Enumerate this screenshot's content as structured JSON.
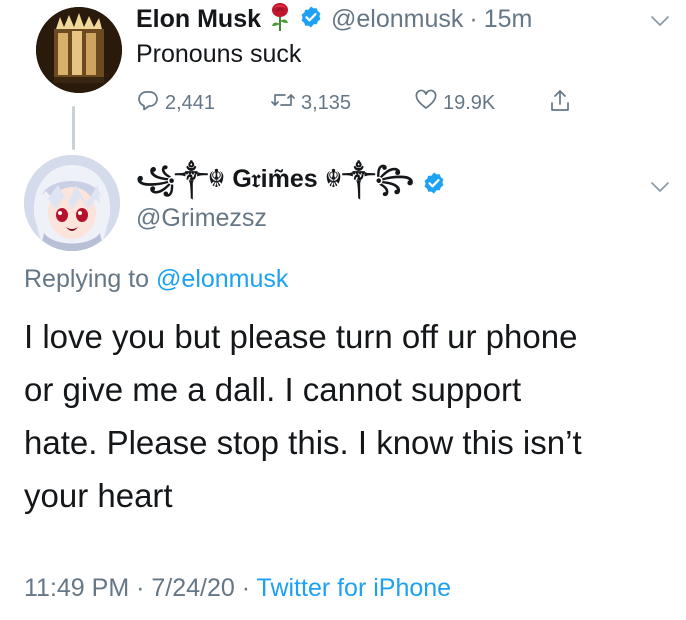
{
  "tweet1": {
    "name": "Elon Musk",
    "name_emoji": "rose-emoji",
    "verified_icon": "verified-badge-icon",
    "handle": "@elonmusk",
    "separator": "·",
    "time": "15m",
    "text": "Pronouns suck",
    "actions": {
      "reply_count": "2,441",
      "retweet_count": "3,135",
      "like_count": "19.9K"
    }
  },
  "tweet2": {
    "display_name": "꧁༒☬ G𝔯im̃es ☬༒꧂",
    "handle": "@Grimezsz",
    "replying_prefix": "Replying to",
    "replying_to": "@elonmusk",
    "text_lines": [
      "I love you but please turn off ur phone",
      "or give me a dall.  I cannot support",
      "hate.  Please stop this. I know this isn’t",
      "your heart"
    ],
    "timestamp": "11:49 PM · 7/24/20",
    "meta_separator": " · ",
    "source": "Twitter for iPhone"
  },
  "colors": {
    "text": "#14171a",
    "secondary": "#657786",
    "link": "#1da1f2",
    "verified": "#1da1f2",
    "rose": "#c0162d"
  }
}
